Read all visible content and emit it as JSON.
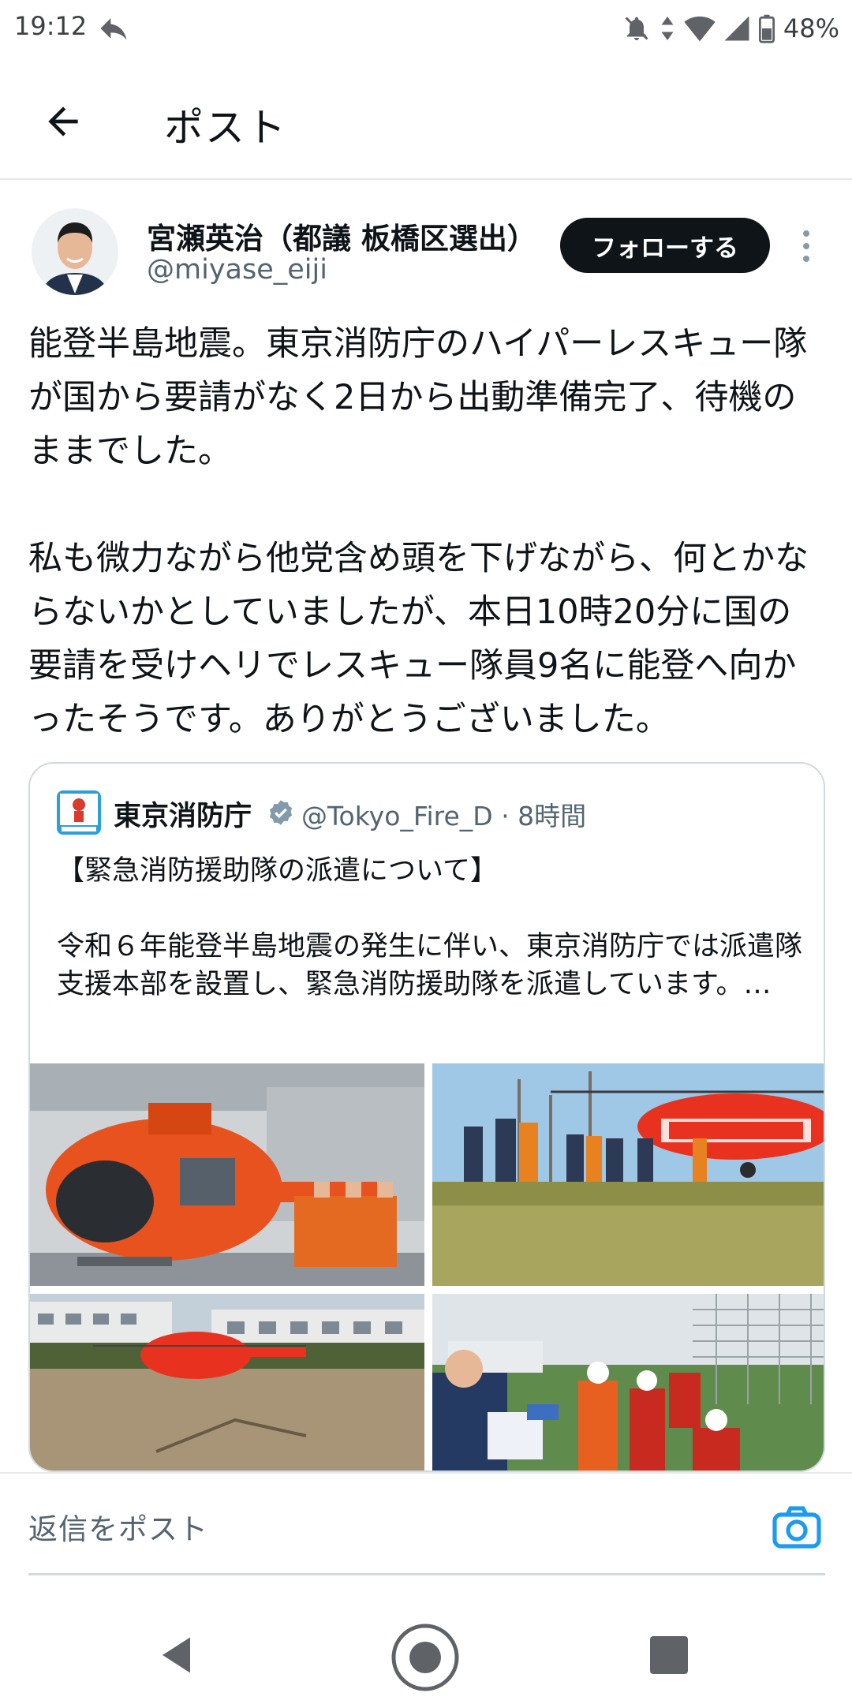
{
  "status_bar": {
    "time": "19:12",
    "battery": "48%",
    "icons": [
      "reply-arrow-icon",
      "bell-off-icon",
      "data-arrows-icon",
      "wifi-icon",
      "signal-icon",
      "battery-icon"
    ]
  },
  "header": {
    "title": "ポスト",
    "back_icon": "arrow-left-icon"
  },
  "author": {
    "name": "宮瀬英治（都議 板橋区選出）",
    "handle": "@miyase_eiji",
    "follow_label": "フォローする",
    "more_icon": "more-vertical-icon"
  },
  "tweet": {
    "paragraphs": [
      "能登半島地震。東京消防庁のハイパーレスキュー隊が国から要請がなく2日から出動準備完了、待機のままでした。",
      "私も微力ながら他党含め頭を下げながら、何とかならないかとしていましたが、本日10時20分に国の要請を受けヘリでレスキュー隊員9名に能登へ向かったそうです。ありがとうございました。"
    ]
  },
  "quote": {
    "name": "東京消防庁",
    "handle_time": "@Tokyo_Fire_D · 8時間",
    "title": "【緊急消防援助隊の派遣について】",
    "body": "令和６年能登半島地震の発生に伴い、東京消防庁では派遣隊支援本部を設置し、緊急消防援助隊を派遣しています。…",
    "images": [
      "helicopter-hangar-photo",
      "helicopter-field-boarding-photo",
      "helicopter-landing-school-photo",
      "rescue-team-unloading-photo"
    ]
  },
  "reply": {
    "placeholder": "返信をポスト",
    "camera_icon": "camera-icon"
  },
  "nav": {
    "icons": [
      "nav-back-icon",
      "nav-home-icon",
      "nav-recents-icon"
    ]
  },
  "colors": {
    "text": "#0f1419",
    "secondary": "#536471",
    "link_blue": "#1d9bf0",
    "follow_bg": "#0f1419",
    "border": "#cfd9de",
    "helicopter_orange": "#e8521f"
  }
}
